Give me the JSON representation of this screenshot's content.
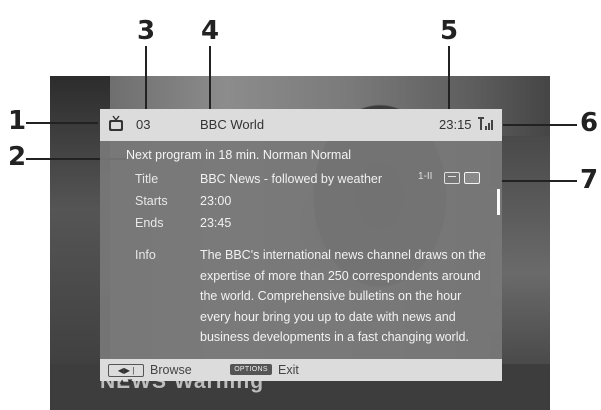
{
  "callouts": [
    "1",
    "2",
    "3",
    "4",
    "5",
    "6",
    "7"
  ],
  "header": {
    "channel_number": "03",
    "channel_name": "BBC World",
    "time": "23:15"
  },
  "body": {
    "next_program": "Next program in 18 min. Norman Normal",
    "fields": [
      {
        "label": "Title",
        "value": "BBC News - followed by weather"
      },
      {
        "label": "Starts",
        "value": "23:00"
      },
      {
        "label": "Ends",
        "value": "23:45"
      },
      {
        "label": "Info",
        "value": ""
      }
    ],
    "info_lines": [
      "The BBC's international news channel draws on the",
      "expertise of more than 250 correspondents around",
      "the world. Comprehensive bulletins on the hour",
      "every hour bring you up to date with news and",
      "business developments in a fast changing world."
    ],
    "mini_icon_text": "1-II"
  },
  "footer": {
    "browse_key": "◀▶ | ▲▼",
    "browse_label": "Browse",
    "options_key": "OPTIONS",
    "exit_label": "Exit"
  },
  "background_text": "NEWS  Warning",
  "icons": [
    "tv-icon",
    "signal-icon",
    "subtitle-icon",
    "mail-icon"
  ]
}
